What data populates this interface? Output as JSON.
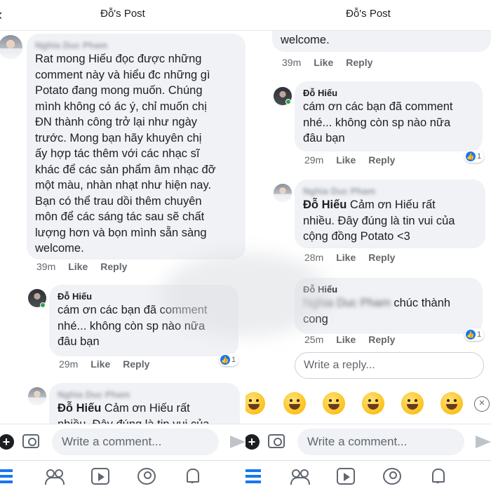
{
  "left": {
    "header": {
      "title": "Đỗ's Post"
    },
    "comments": [
      {
        "author": "Nghia Duc Pham",
        "text": "Rat mong Hiếu đọc được những\ncomment này và hiểu đc những gì\nPotato đang mong muốn. Chúng\nmình không có ác ý, chỉ muốn chị\nĐN thành công trở lại như ngày\ntrước. Mong bạn hãy khuyên chị\nấy hợp tác thêm với các nhạc sĩ\nkhác để các sản phẩm âm nhạc đỡ\nmột màu, nhàn nhạt như hiện nay.\nBạn có thể trau dồi thêm chuyên\nmôn để các sáng tác sau sẽ chất\nlượng hơn và bọn mình sẵn sàng\nwelcome.",
        "time": "39m",
        "like": "Like",
        "reply": "Reply"
      },
      {
        "author": "Đỗ Hiếu",
        "text": "cám ơn các bạn đã comment\nnhé... không còn sp nào nữa\nđâu bạn",
        "time": "29m",
        "like": "Like",
        "reply": "Reply",
        "reactions": "1"
      },
      {
        "author": "Nghia Duc Pham",
        "mention": "Đỗ Hiếu",
        "text": " Cảm ơn Hiếu rất\nnhiều. Đây đúng là tin vui của"
      }
    ],
    "composer": {
      "placeholder": "Write a comment..."
    }
  },
  "right": {
    "header": {
      "title": "Đỗ's Post"
    },
    "tail": {
      "text": "welcome.",
      "time": "39m",
      "like": "Like",
      "reply": "Reply"
    },
    "comments": [
      {
        "author": "Đỗ Hiếu",
        "text": "cám ơn các bạn đã comment\nnhé... không còn sp nào nữa\nđâu bạn",
        "time": "29m",
        "like": "Like",
        "reply": "Reply",
        "reactions": "1"
      },
      {
        "author": "Nghia Duc Pham",
        "mention": "Đỗ Hiếu",
        "text": " Cảm ơn Hiếu rất\nnhiều. Đây đúng là tin vui của\ncộng đồng Potato <3",
        "time": "28m",
        "like": "Like",
        "reply": "Reply"
      },
      {
        "author": "Đỗ Hiếu",
        "mention": "Nghia Duc Pham",
        "text": " chúc thành\ncong",
        "time": "25m",
        "like": "Like",
        "reply": "Reply",
        "reactions": "1"
      }
    ],
    "reply_box": {
      "placeholder": "Write a reply..."
    },
    "composer": {
      "placeholder": "Write a comment..."
    }
  }
}
